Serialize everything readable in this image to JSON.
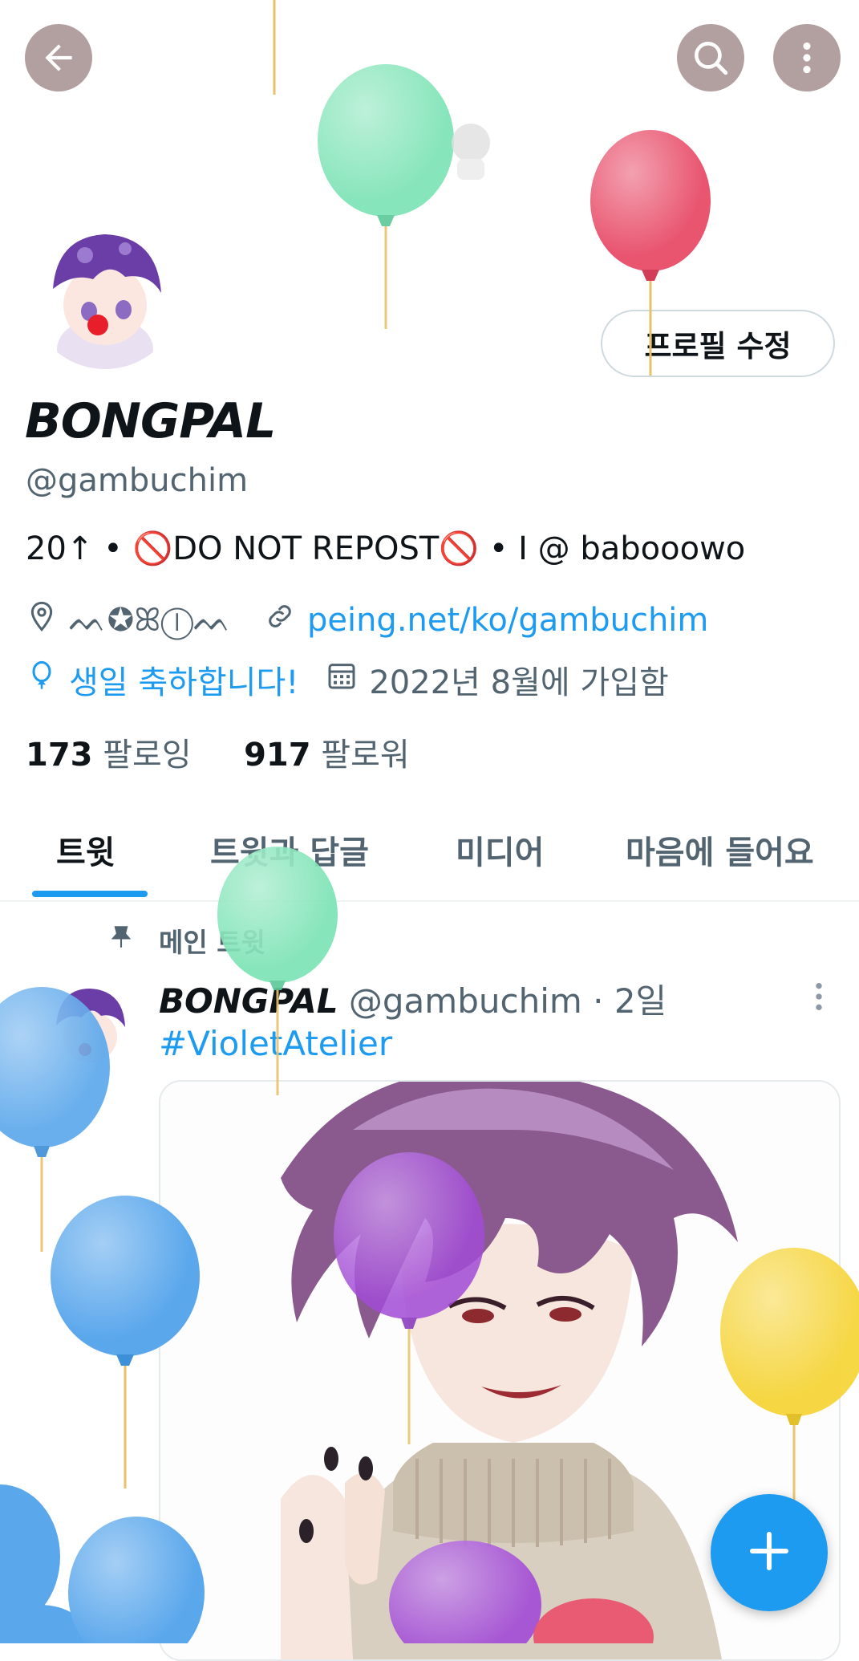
{
  "header": {
    "back_icon": "arrow-left-icon",
    "search_icon": "search-icon",
    "more_icon": "more-vertical-icon"
  },
  "profile": {
    "edit_label": "프로필 수정",
    "display_name": "BONGPAL",
    "handle": "@gambuchim",
    "bio_prefix": "20↑ • ",
    "bio_ban1": "🚫",
    "bio_middle": "DO NOT REPOST",
    "bio_ban2": "🚫",
    "bio_suffix": "  •  I @ babooowo",
    "location": "ᨓ✪ꕤⓛᨓ",
    "website": "peing.net/ko/gambuchim",
    "birthday": "생일 축하합니다!",
    "joined": "2022년 8월에 가입함",
    "following_count": "173",
    "following_label": "팔로잉",
    "followers_count": "917",
    "followers_label": "팔로워"
  },
  "tabs": [
    {
      "label": "트윗",
      "active": true
    },
    {
      "label": "트윗과 답글",
      "active": false
    },
    {
      "label": "미디어",
      "active": false
    },
    {
      "label": "마음에 들어요",
      "active": false
    }
  ],
  "tweet": {
    "pinned_label": "메인 트윗",
    "author_name": "BONGPAL",
    "author_meta": " @gambuchim · 2일",
    "hashtag": "#VioletAtelier"
  },
  "fab": {
    "icon": "plus-icon"
  },
  "colors": {
    "accent": "#1d9bf0",
    "balloon_green": "#7be3b4",
    "balloon_red": "#e9546f",
    "balloon_blue": "#5aa7ec",
    "balloon_purple": "#a24bd6",
    "balloon_yellow": "#f6d53a"
  }
}
